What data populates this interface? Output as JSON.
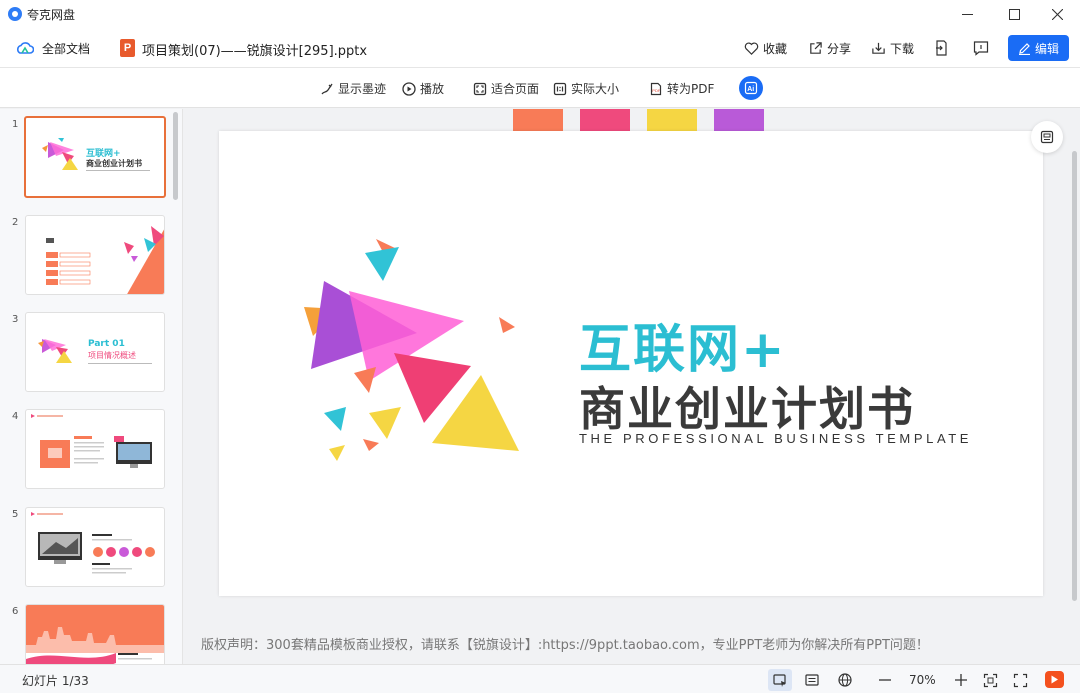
{
  "app": {
    "title": "夸克网盘"
  },
  "window": {
    "minimize": "—",
    "maximize": "☐",
    "close": "✕"
  },
  "header": {
    "all_docs": "全部文档",
    "file_icon": "P",
    "file_name": "项目策划(07)——锐旗设计[295].pptx",
    "favorite": "收藏",
    "share": "分享",
    "download": "下载",
    "edit": "编辑"
  },
  "toolbar": {
    "show_ink": "显示墨迹",
    "play": "播放",
    "fit_page": "适合页面",
    "actual_size": "实际大小",
    "to_pdf": "转为PDF"
  },
  "thumbnails": [
    {
      "num": "1",
      "active": true
    },
    {
      "num": "2"
    },
    {
      "num": "3"
    },
    {
      "num": "4"
    },
    {
      "num": "5"
    },
    {
      "num": "6"
    }
  ],
  "thumb_text": {
    "t1_title": "互联网+",
    "t1_sub": "商业创业计划书",
    "t3_part": "Part 01",
    "t3_sub": "项目情况概述"
  },
  "slide": {
    "title_line1": "互联网+",
    "title_line2": "商业创业计划书",
    "subtitle": "THE PROFESSIONAL BUSINESS TEMPLATE",
    "tab_colors": [
      "#f87b57",
      "#ef4a7d",
      "#f5d643",
      "#b95ad8"
    ]
  },
  "copyright": "版权声明：300套精品模板商业授权，请联系【锐旗设计】:https://9ppt.taobao.com，专业PPT老师为你解决所有PPT问题！",
  "status": {
    "slide_counter": "幻灯片 1/33",
    "zoom": "70%"
  },
  "colors": {
    "accent": "#1a6cf5",
    "brand_orange": "#e85a2c",
    "title_cyan": "#2bbed2"
  }
}
